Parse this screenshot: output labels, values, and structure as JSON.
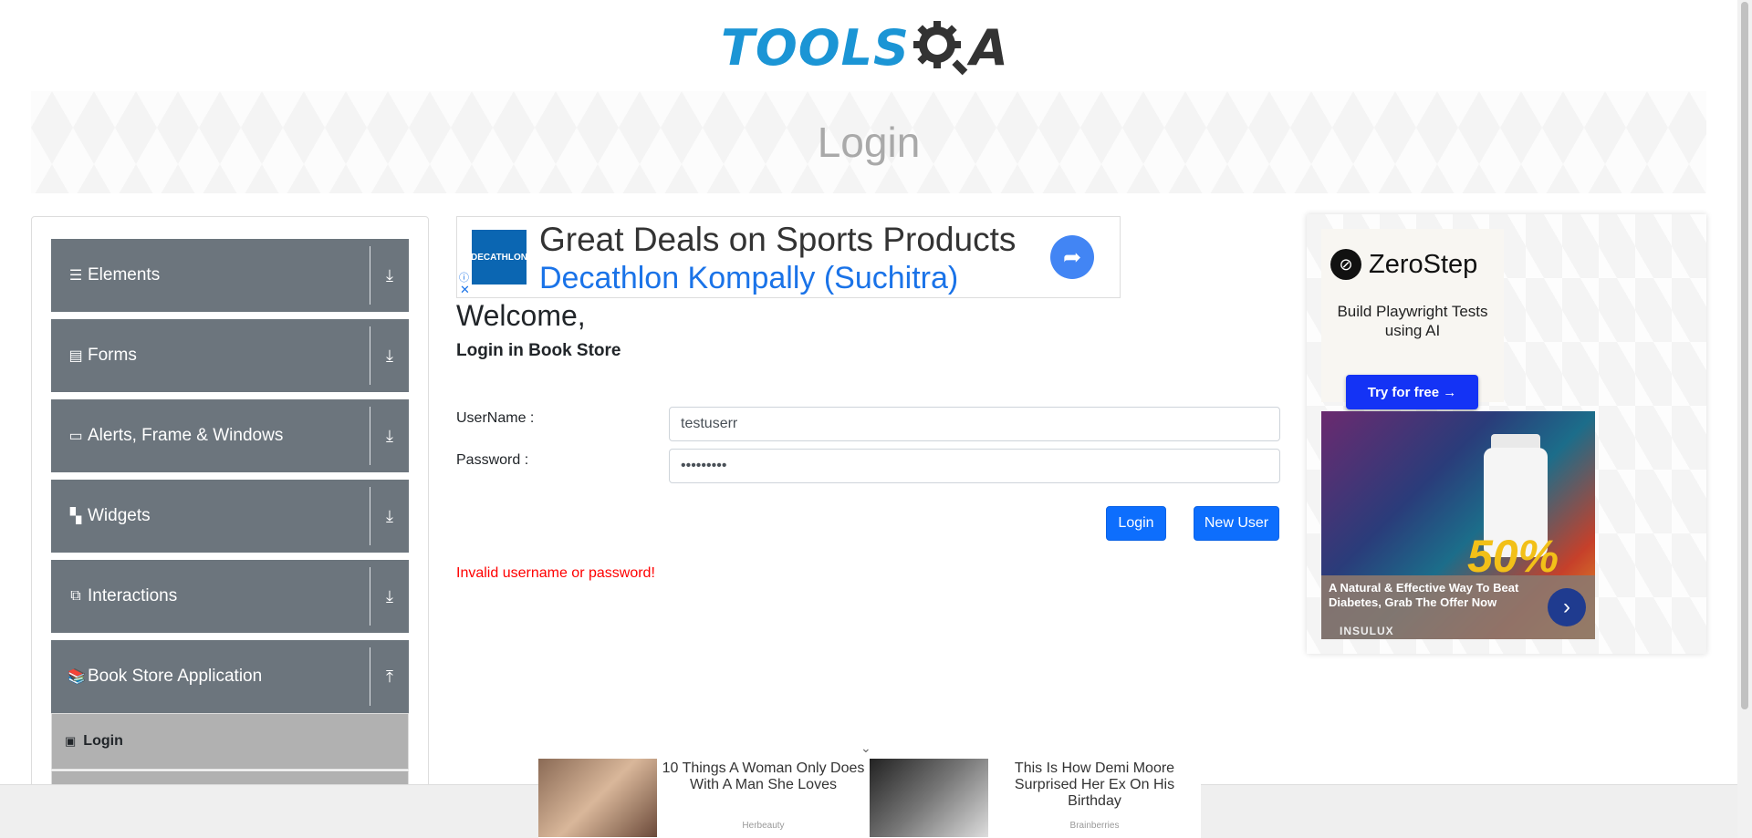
{
  "logo": {
    "text_left": "TOOLS",
    "text_right": "A"
  },
  "banner": {
    "title": "Login"
  },
  "nav": {
    "groups": [
      {
        "label": "Elements",
        "icon": "hamburger-icon"
      },
      {
        "label": "Forms",
        "icon": "document-icon"
      },
      {
        "label": "Alerts, Frame & Windows",
        "icon": "window-icon"
      },
      {
        "label": "Widgets",
        "icon": "widgets-icon"
      },
      {
        "label": "Interactions",
        "icon": "interactions-icon"
      },
      {
        "label": "Book Store Application",
        "icon": "books-icon"
      }
    ],
    "active_item": {
      "label": "Login",
      "icon": "html-icon"
    }
  },
  "ad_top": {
    "brand": "DECATHLON",
    "title": "Great Deals on Sports Products",
    "subtitle": "Decathlon Kompally (Suchitra)",
    "info": "ⓘ",
    "close": "✕"
  },
  "login": {
    "welcome": "Welcome,",
    "subheading": "Login in Book Store",
    "username_label": "UserName :",
    "username_value": "testuserr",
    "password_label": "Password :",
    "password_value": "•••••••••",
    "login_button": "Login",
    "new_user_button": "New User",
    "error": "Invalid username or password!"
  },
  "ad_right": {
    "brand": "ZeroStep",
    "tagline": "Build Playwright Tests using AI",
    "cta": "Try for free →",
    "product_text": "A Natural & Effective Way To Beat Diabetes, Grab The Offer Now",
    "product_brand": "INSULUX",
    "product_percent": "50%"
  },
  "bottom_ads": [
    {
      "title": "10 Things A Woman Only Does With A Man She Loves",
      "source": "Herbeauty"
    },
    {
      "title": "This Is How Demi Moore Surprised Her Ex On His Birthday",
      "source": "Brainberries"
    }
  ],
  "colors": {
    "brand_blue": "#1b95d5",
    "nav_gray": "#6c757d",
    "button_blue": "#0d6efd",
    "error_red": "#ff0000"
  }
}
